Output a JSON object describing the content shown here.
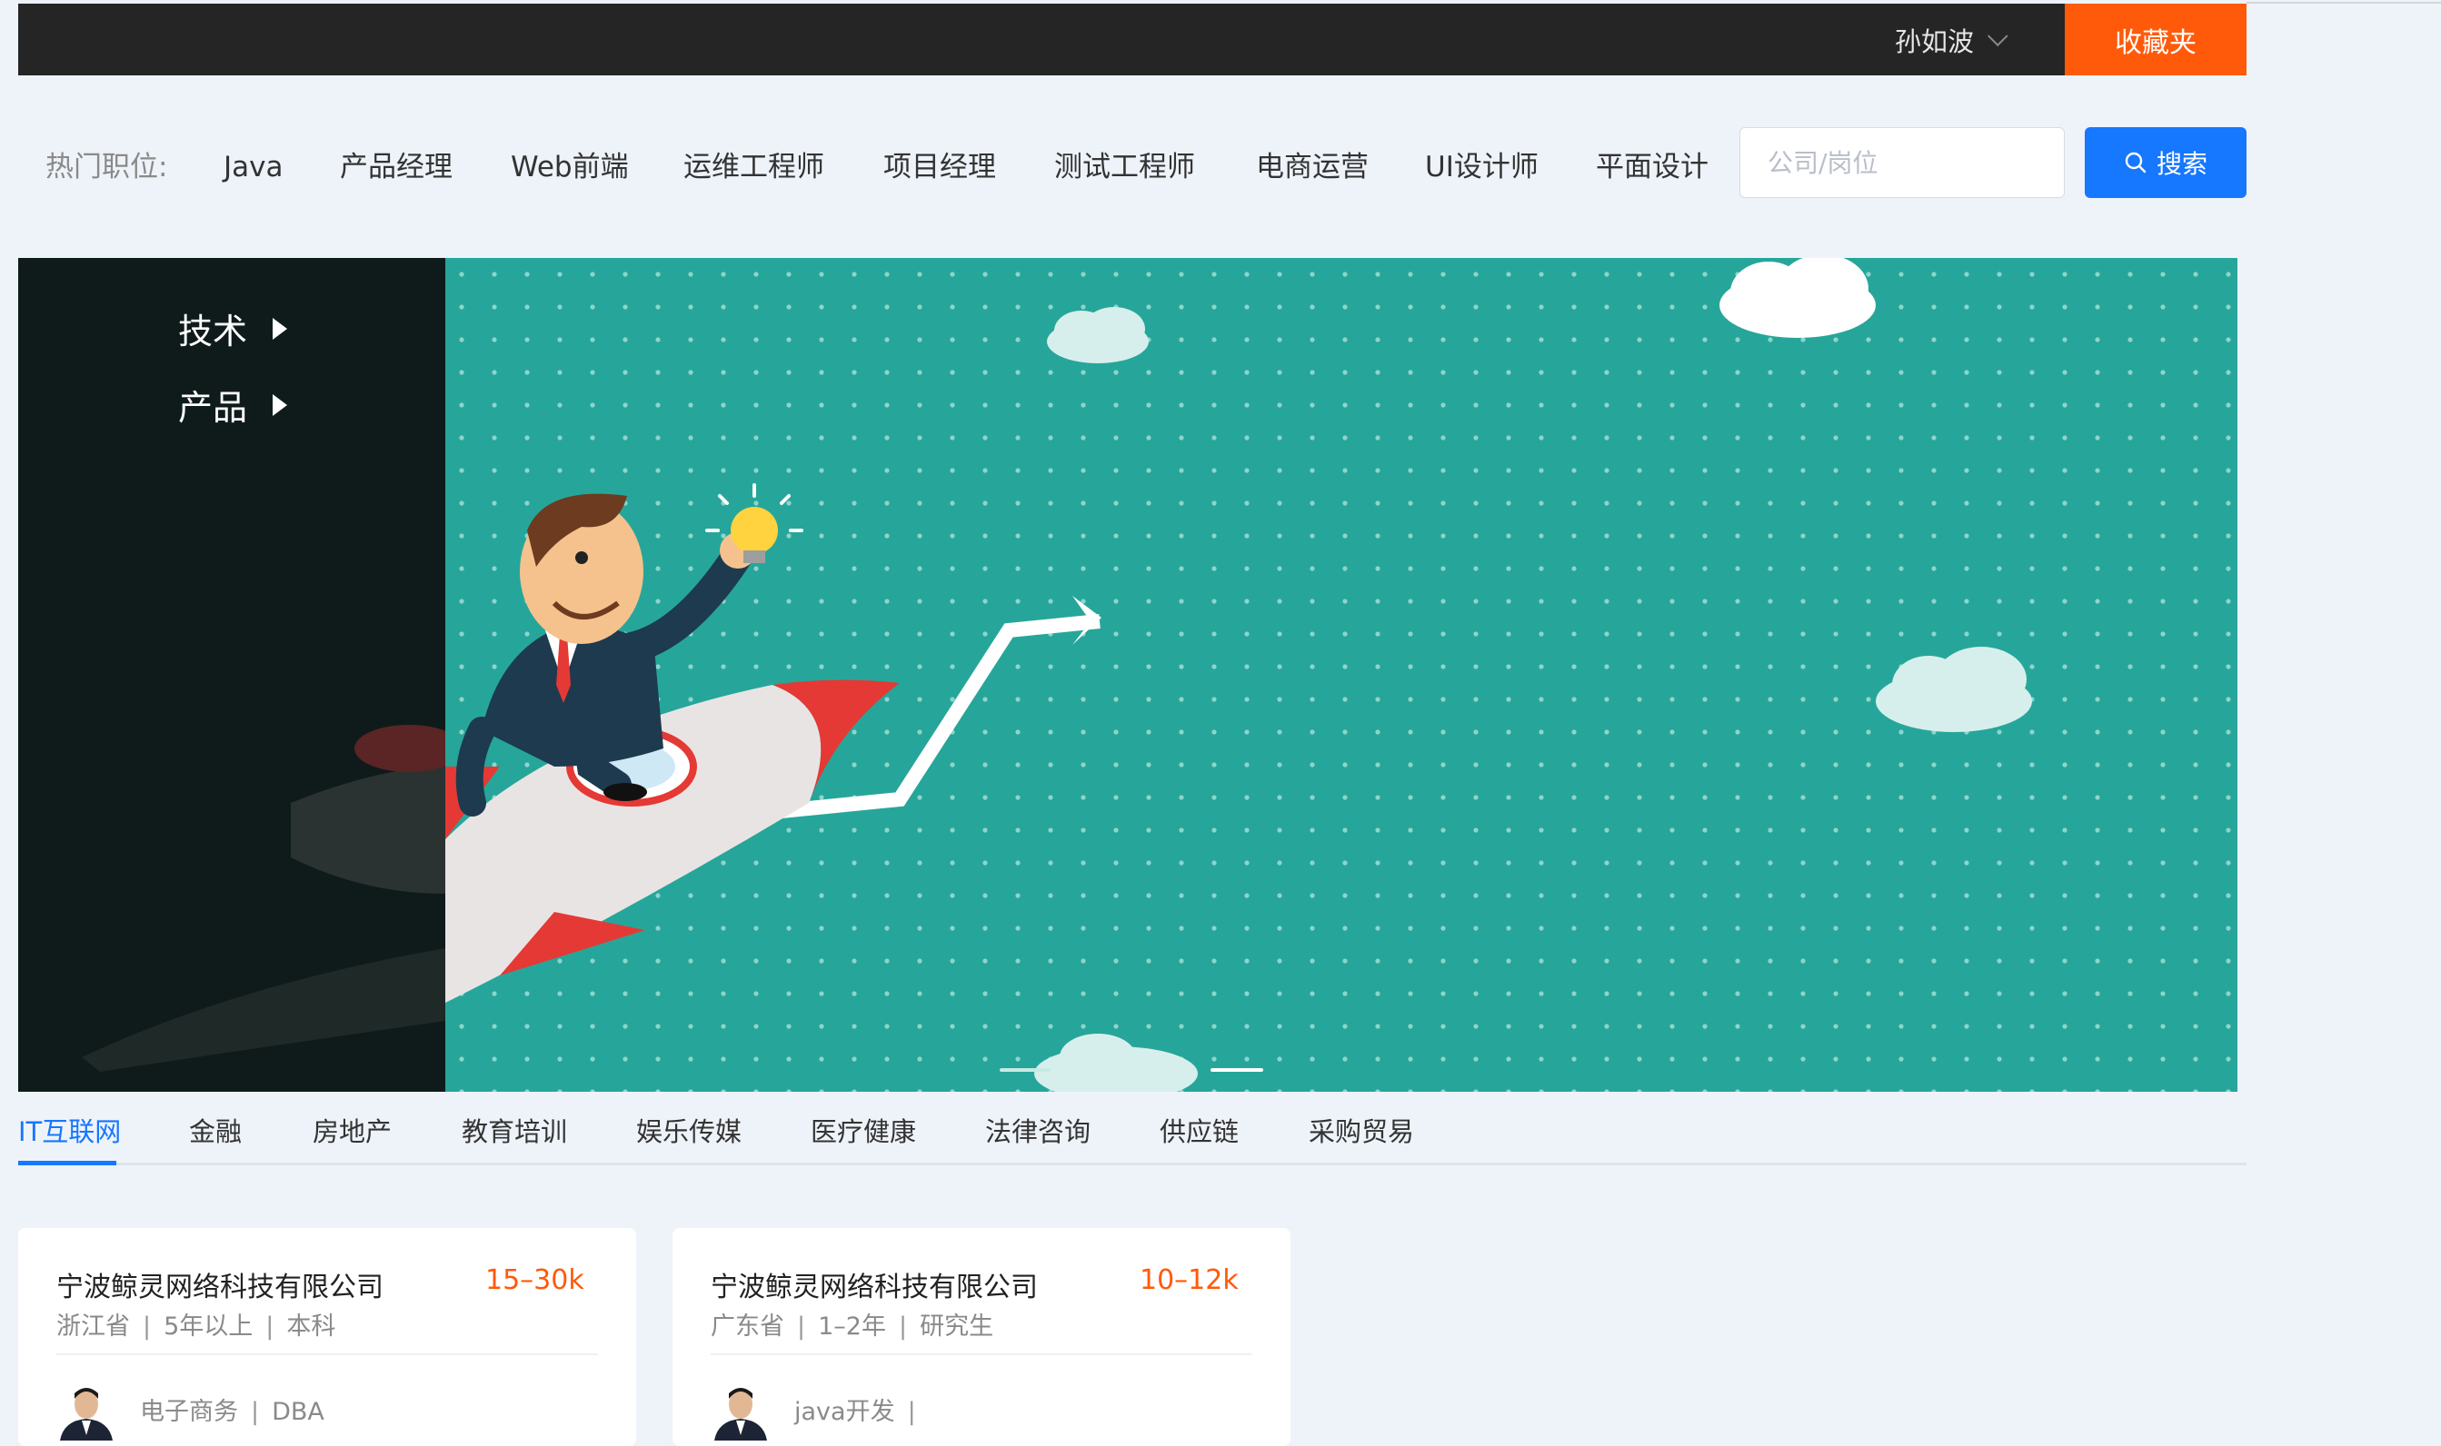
{
  "topbar": {
    "user_name": "孙如波",
    "favorites_label": "收藏夹"
  },
  "hot": {
    "label": "热门职位:",
    "items": [
      "Java",
      "产品经理",
      "Web前端",
      "运维工程师",
      "项目经理",
      "测试工程师",
      "电商运营",
      "UI设计师",
      "平面设计"
    ]
  },
  "search": {
    "placeholder": "公司/岗位",
    "value": "",
    "button_label": "搜索"
  },
  "banner": {
    "categories": [
      "技术",
      "产品"
    ],
    "active_slide": 2,
    "slide_count": 2
  },
  "industry_tabs": {
    "items": [
      "IT互联网",
      "金融",
      "房地产",
      "教育培训",
      "娱乐传媒",
      "医疗健康",
      "法律咨询",
      "供应链",
      "采购贸易"
    ],
    "active_index": 0
  },
  "jobs": [
    {
      "company": "宁波鲸灵网络科技有限公司",
      "salary": "15–30k",
      "location": "浙江省",
      "experience": "5年以上",
      "education": "本科",
      "tags": [
        "电子商务",
        "DBA"
      ]
    },
    {
      "company": "宁波鲸灵网络科技有限公司",
      "salary": "10–12k",
      "location": "广东省",
      "experience": "1–2年",
      "education": "研究生",
      "tags": [
        "java开发",
        ""
      ]
    }
  ],
  "colors": {
    "accent": "#1677ff",
    "orange": "#ff5a0a",
    "topbar": "#252525",
    "banner_teal": "#26a69a"
  }
}
